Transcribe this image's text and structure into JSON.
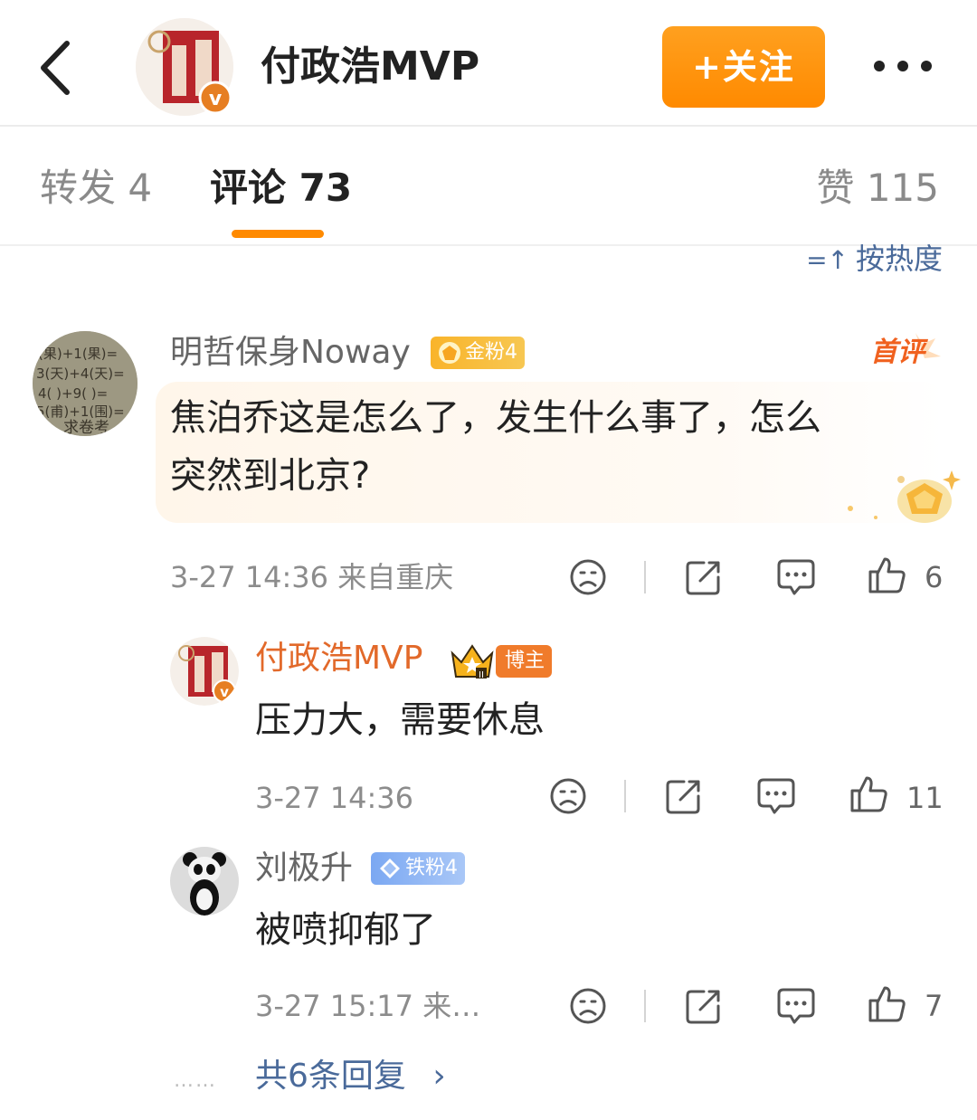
{
  "header": {
    "title": "付政浩MVP",
    "follow_label": "+关注"
  },
  "tabs": {
    "repost": "转发 4",
    "comment": "评论 73",
    "like": "赞 115"
  },
  "sort": {
    "icon": "sort-icon",
    "label": "按热度",
    "icon_glyph": "=↑"
  },
  "colors": {
    "accent": "#ff8a00",
    "link": "#4a6a9a",
    "blogger_name": "#e2692a"
  },
  "comments": [
    {
      "user": "明哲保身Noway",
      "badge": "金粉4",
      "tag": "首评",
      "text_line1": "焦泊乔这是怎么了，发生什么事了，怎么",
      "text_line2": "突然到北京?",
      "time": "3-27 14:36 来自重庆",
      "likes": "6"
    }
  ],
  "replies": [
    {
      "user": "付政浩MVP",
      "badge": "博主",
      "text": "压力大，需要休息",
      "time": "3-27 14:36",
      "likes": "11"
    },
    {
      "user": "刘极升",
      "badge": "铁粉4",
      "text": "被喷抑郁了",
      "time": "3-27 15:17 来…",
      "likes": "7"
    }
  ],
  "more_replies": {
    "dots": "……",
    "label": "共6条回复",
    "arrow": "›"
  }
}
